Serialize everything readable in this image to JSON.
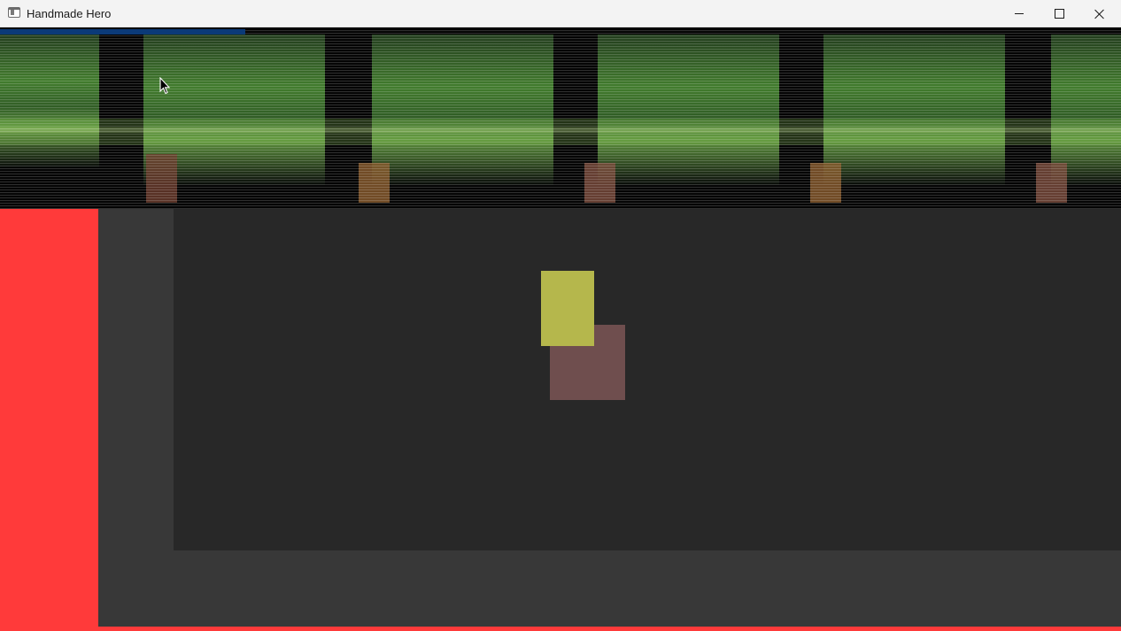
{
  "window": {
    "title": "Handmade Hero",
    "app_icon": "window-app-icon",
    "controls": {
      "minimize_icon": "minimize-icon",
      "maximize_icon": "maximize-icon",
      "close_icon": "close-icon"
    }
  },
  "scene": {
    "colors": {
      "wall": "#ff3a3a",
      "floor_outer": "#383838",
      "floor_inner": "#282828",
      "player": "#b5b74c",
      "player_shadow": "#6f4e4e",
      "debug_bar": "#0b3a78"
    },
    "entities": [
      {
        "name": "player",
        "color": "#b5b74c"
      },
      {
        "name": "player-shadow",
        "color": "#6f4e4e"
      }
    ]
  }
}
